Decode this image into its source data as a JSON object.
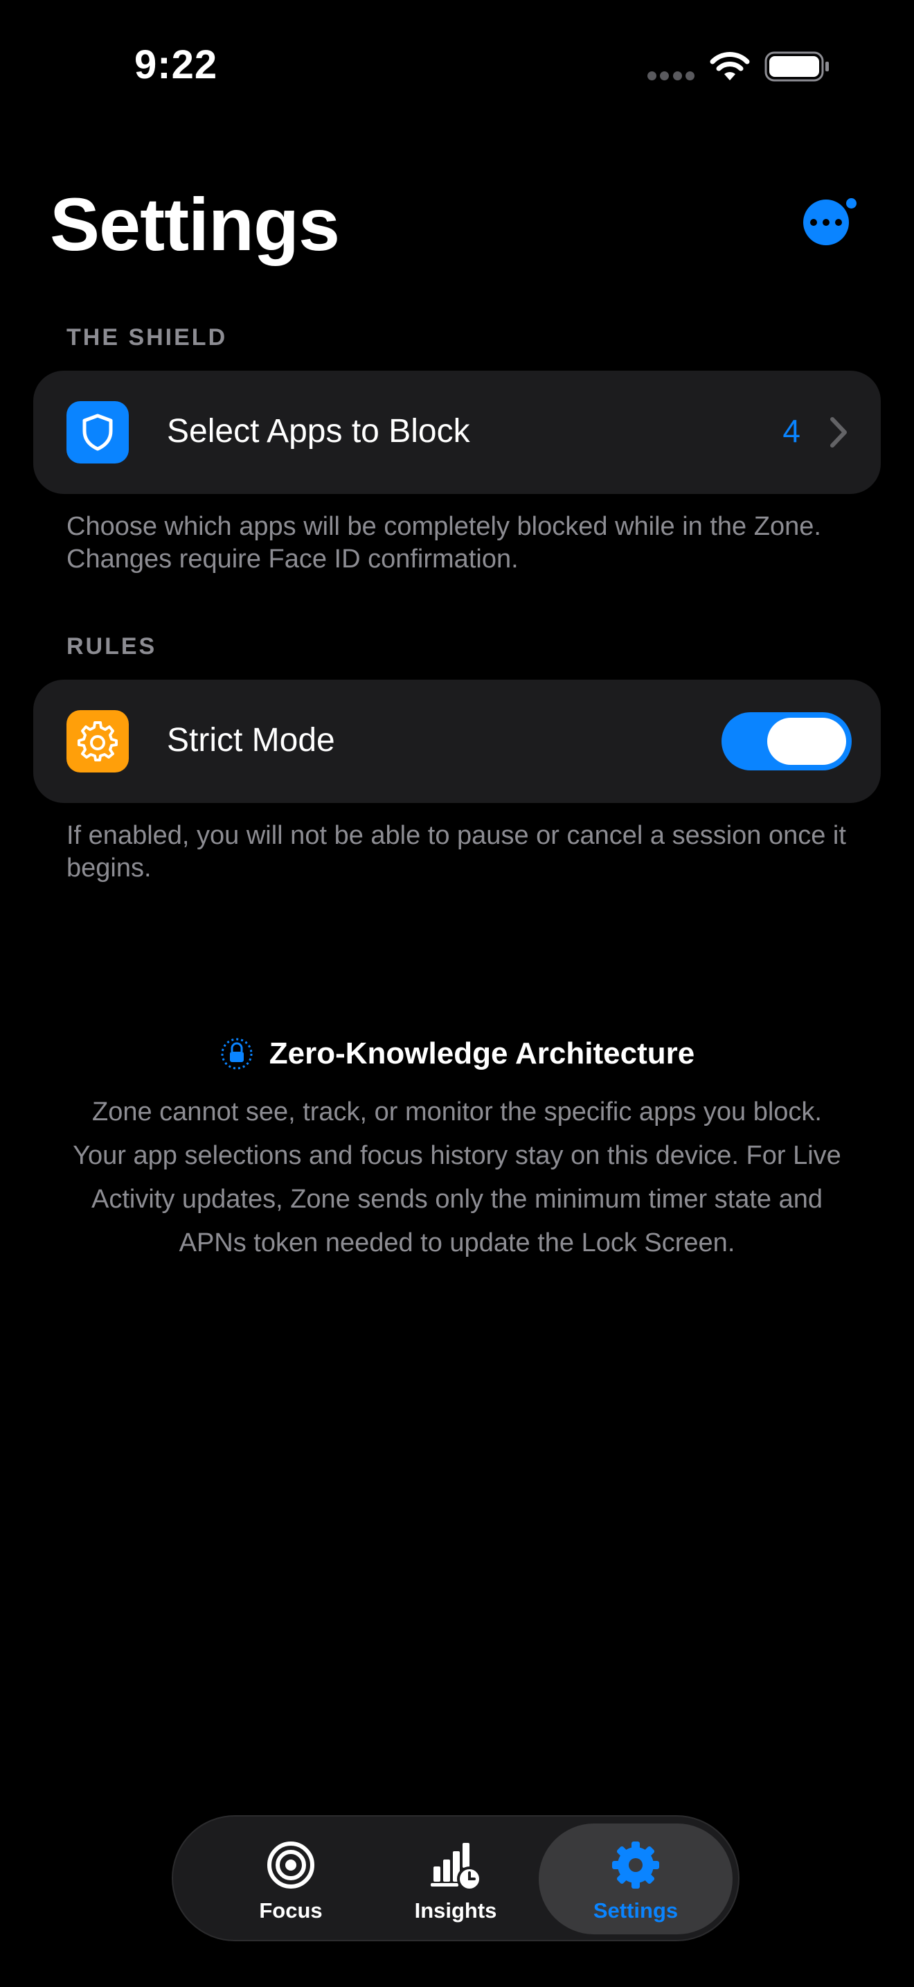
{
  "status_bar": {
    "time": "9:22",
    "icons": [
      "signal-dots-icon",
      "wifi-icon",
      "battery-icon"
    ]
  },
  "header": {
    "title": "Settings",
    "more_icon": "ellipsis-circle-icon"
  },
  "shield_section": {
    "header": "THE SHIELD",
    "row": {
      "icon": "shield-icon",
      "label": "Select Apps to Block",
      "count": "4"
    },
    "footer": "Choose which apps will be completely blocked while in the Zone. Changes require Face ID confirmation."
  },
  "rules_section": {
    "header": "RULES",
    "row": {
      "icon": "gear-icon",
      "label": "Strict Mode",
      "enabled": true
    },
    "footer": "If enabled, you will not be able to pause or cancel a session once it begins."
  },
  "privacy": {
    "icon": "lock-icon",
    "title": "Zero-Knowledge Architecture",
    "body": "Zone cannot see, track, or monitor the specific apps you block. Your app selections and focus history stay on this device. For Live Activity updates, Zone sends only the minimum timer state and APNs token needed to update the Lock Screen."
  },
  "tab_bar": {
    "tabs": [
      {
        "label": "Focus",
        "icon": "target-icon",
        "active": false
      },
      {
        "label": "Insights",
        "icon": "chart-clock-icon",
        "active": false
      },
      {
        "label": "Settings",
        "icon": "gear-icon",
        "active": true
      }
    ]
  },
  "colors": {
    "accent": "#0a84ff",
    "shield_icon_bg": "#0a84ff",
    "rules_icon_bg": "#ff9f0a",
    "card_bg": "#1c1c1e",
    "secondary_text": "#8d8d93"
  }
}
